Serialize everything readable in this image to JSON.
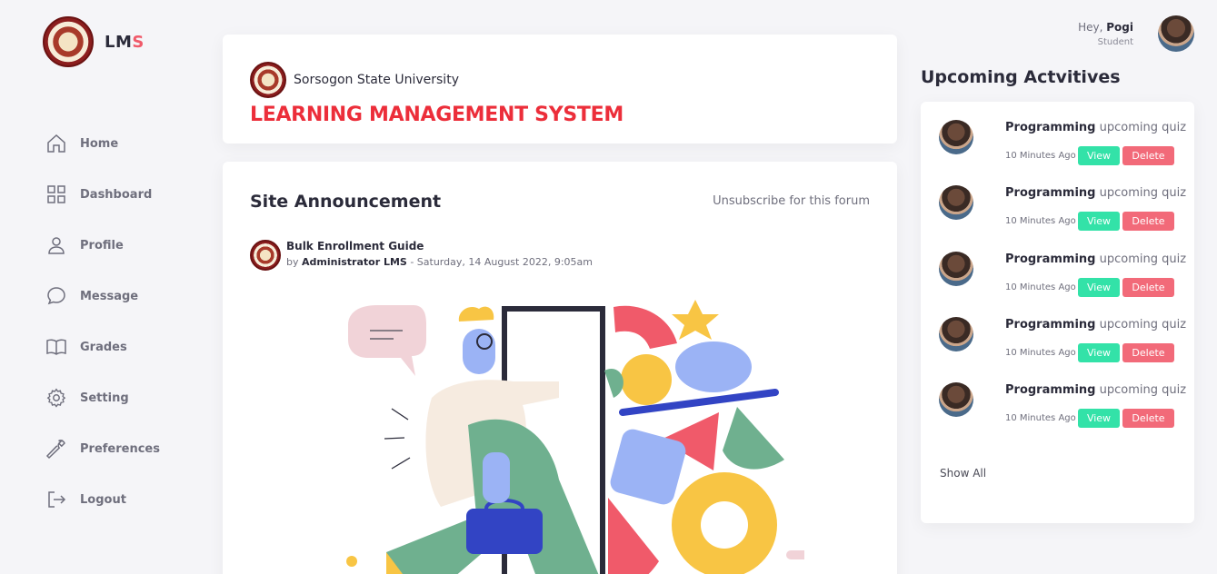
{
  "brand": {
    "name_prefix": "LM",
    "name_accent": "S"
  },
  "sidebar": {
    "items": [
      {
        "label": "Home",
        "icon": "home-icon"
      },
      {
        "label": "Dashboard",
        "icon": "grid-icon"
      },
      {
        "label": "Profile",
        "icon": "user-icon"
      },
      {
        "label": "Message",
        "icon": "message-icon"
      },
      {
        "label": "Grades",
        "icon": "book-icon"
      },
      {
        "label": "Setting",
        "icon": "gear-icon"
      },
      {
        "label": "Preferences",
        "icon": "wrench-icon"
      },
      {
        "label": "Logout",
        "icon": "logout-icon"
      }
    ]
  },
  "header": {
    "university": "Sorsogon State University",
    "system_title": "LEARNING MANAGEMENT SYSTEM"
  },
  "announcement": {
    "title": "Site Announcement",
    "unsubscribe": "Unsubscribe for this forum",
    "post_title": "Bulk Enrollment Guide",
    "post_by_prefix": "by",
    "post_author": "Administrator LMS",
    "post_date": "- Saturday, 14 August 2022, 9:05am"
  },
  "user": {
    "greeting": "Hey,",
    "name": "Pogi",
    "role": "Student"
  },
  "activities": {
    "heading": "Upcoming Actvitives",
    "items": [
      {
        "subject": "Programming",
        "desc": "upcoming quiz",
        "time": "10 Minutes Ago",
        "view": "View",
        "delete": "Delete"
      },
      {
        "subject": "Programming",
        "desc": "upcoming quiz",
        "time": "10 Minutes Ago",
        "view": "View",
        "delete": "Delete"
      },
      {
        "subject": "Programming",
        "desc": "upcoming quiz",
        "time": "10 Minutes Ago",
        "view": "View",
        "delete": "Delete"
      },
      {
        "subject": "Programming",
        "desc": "upcoming quiz",
        "time": "10 Minutes Ago",
        "view": "View",
        "delete": "Delete"
      },
      {
        "subject": "Programming",
        "desc": "upcoming quiz",
        "time": "10 Minutes Ago",
        "view": "View",
        "delete": "Delete"
      }
    ],
    "show_all": "Show All"
  },
  "colors": {
    "accent_red": "#ec2e3a",
    "view_green": "#33e2a8",
    "delete_red": "#f26a79"
  }
}
